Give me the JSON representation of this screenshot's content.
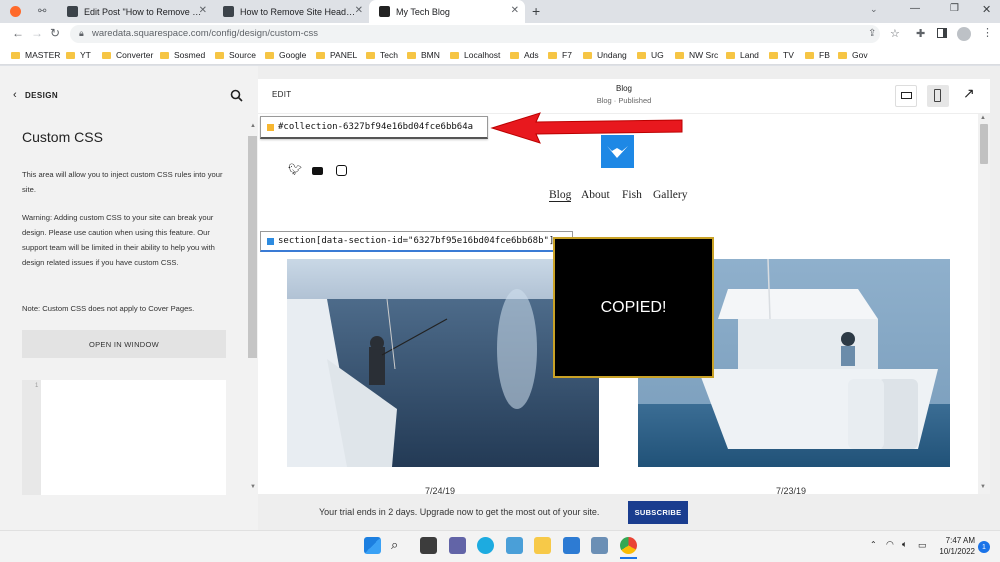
{
  "browser": {
    "tabs": [
      {
        "title": "",
        "icon": "ahrefs-icon"
      },
      {
        "title": "",
        "icon": "link-icon"
      },
      {
        "title": "Edit Post \"How to Remove Site H",
        "icon": "wordpress-icon"
      },
      {
        "title": "How to Remove Site Header Squ",
        "icon": "wordpress-icon"
      },
      {
        "title": "My Tech Blog",
        "icon": "squarespace-icon",
        "active": true
      }
    ],
    "new_tab": "+",
    "url": "waredata.squarespace.com/config/design/custom-css",
    "bookmarks": [
      "MASTER",
      "YT",
      "Converter",
      "Sosmed",
      "Source",
      "Google",
      "PANEL",
      "Tech",
      "BMN",
      "Localhost",
      "Ads",
      "F7",
      "Undang",
      "UG",
      "NW Src",
      "Land",
      "TV",
      "FB",
      "Gov"
    ]
  },
  "panel": {
    "back_label": "DESIGN",
    "title": "Custom CSS",
    "intro": "This area will allow you to inject custom CSS rules into your site.",
    "warning": "Warning: Adding custom CSS to your site can break your design. Please use caution when using this feature. Our support team will be limited in their ability to help you with design related issues if you have custom CSS.",
    "note": "Note: Custom CSS does not apply to Cover Pages.",
    "open_window": "OPEN IN WINDOW",
    "line_number": "1"
  },
  "preview": {
    "edit": "EDIT",
    "page_title": "Blog",
    "page_status": "Blog · Published",
    "collection_selector": "#collection-6327bf94e16bd04fce6bb64a",
    "section_selector": "section[data-section-id=\"6327bf95e16bd04fce6bb68b\"]",
    "copied": "COPIED!",
    "nav": [
      "Blog",
      "About",
      "Fish",
      "Gallery"
    ],
    "dates": [
      "7/24/19",
      "7/23/19"
    ]
  },
  "trial": {
    "message": "Your trial ends in 2 days. Upgrade now to get the most out of your site.",
    "subscribe": "SUBSCRIBE"
  },
  "taskbar": {
    "time": "7:47 AM",
    "date": "10/1/2022",
    "notifications": "1"
  },
  "colors": {
    "accent": "#1a3d8f",
    "arrow": "#e8181e",
    "logo": "#1e88e5",
    "copied_border": "#c9a227"
  }
}
